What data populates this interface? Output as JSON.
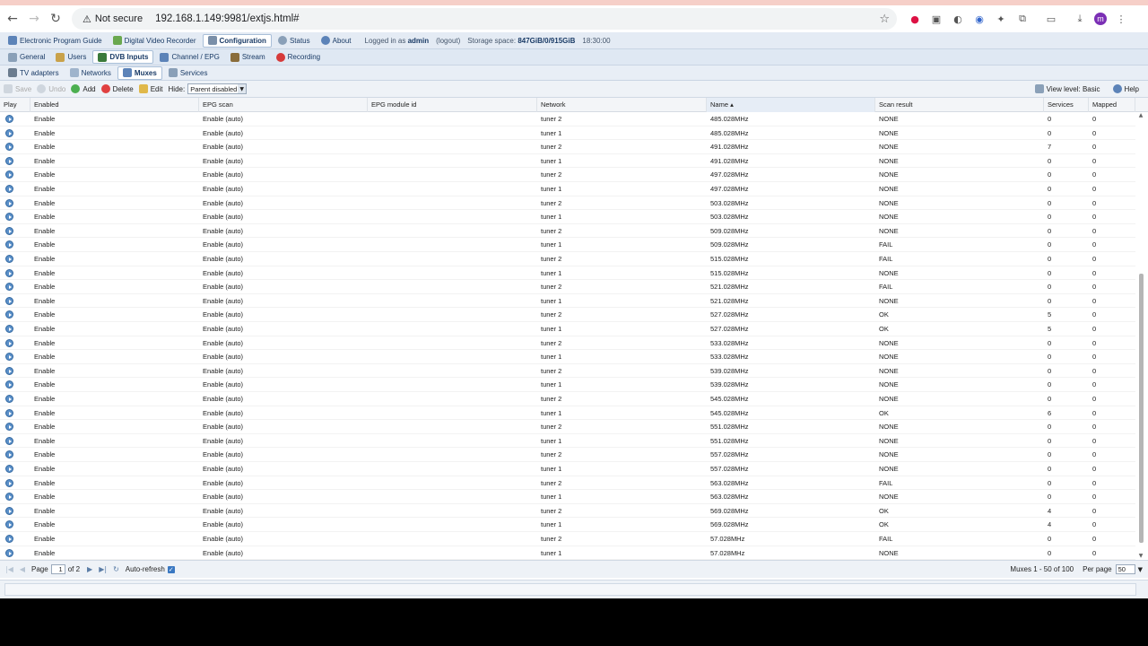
{
  "browser": {
    "security_label": "Not secure",
    "url": "192.168.1.149:9981/extjs.html#",
    "profile_initial": "m"
  },
  "topnav": {
    "tabs": [
      "Electronic Program Guide",
      "Digital Video Recorder",
      "Configuration",
      "Status",
      "About"
    ],
    "logged_in_prefix": "Logged in as",
    "user": "admin",
    "logout": "(logout)",
    "storage_label": "Storage space:",
    "storage_value": "847GiB/0/915GiB",
    "time": "18:30:00"
  },
  "subnav": {
    "tabs": [
      "General",
      "Users",
      "DVB Inputs",
      "Channel / EPG",
      "Stream",
      "Recording"
    ]
  },
  "subnav2": {
    "tabs": [
      "TV adapters",
      "Networks",
      "Muxes",
      "Services"
    ]
  },
  "toolbar": {
    "save": "Save",
    "undo": "Undo",
    "add": "Add",
    "delete": "Delete",
    "edit": "Edit",
    "hide_label": "Hide:",
    "hide_value": "Parent disabled",
    "view_level": "View level: Basic",
    "help": "Help"
  },
  "columns": [
    "Play",
    "Enabled",
    "EPG scan",
    "EPG module id",
    "Network",
    "Name",
    "Scan result",
    "Services",
    "Mapped"
  ],
  "rows": [
    [
      "Enable",
      "Enable (auto)",
      "",
      "tuner 2",
      "485.028MHz",
      "NONE",
      "0",
      "0"
    ],
    [
      "Enable",
      "Enable (auto)",
      "",
      "tuner 1",
      "485.028MHz",
      "NONE",
      "0",
      "0"
    ],
    [
      "Enable",
      "Enable (auto)",
      "",
      "tuner 2",
      "491.028MHz",
      "NONE",
      "7",
      "0"
    ],
    [
      "Enable",
      "Enable (auto)",
      "",
      "tuner 1",
      "491.028MHz",
      "NONE",
      "0",
      "0"
    ],
    [
      "Enable",
      "Enable (auto)",
      "",
      "tuner 2",
      "497.028MHz",
      "NONE",
      "0",
      "0"
    ],
    [
      "Enable",
      "Enable (auto)",
      "",
      "tuner 1",
      "497.028MHz",
      "NONE",
      "0",
      "0"
    ],
    [
      "Enable",
      "Enable (auto)",
      "",
      "tuner 2",
      "503.028MHz",
      "NONE",
      "0",
      "0"
    ],
    [
      "Enable",
      "Enable (auto)",
      "",
      "tuner 1",
      "503.028MHz",
      "NONE",
      "0",
      "0"
    ],
    [
      "Enable",
      "Enable (auto)",
      "",
      "tuner 2",
      "509.028MHz",
      "NONE",
      "0",
      "0"
    ],
    [
      "Enable",
      "Enable (auto)",
      "",
      "tuner 1",
      "509.028MHz",
      "FAIL",
      "0",
      "0"
    ],
    [
      "Enable",
      "Enable (auto)",
      "",
      "tuner 2",
      "515.028MHz",
      "FAIL",
      "0",
      "0"
    ],
    [
      "Enable",
      "Enable (auto)",
      "",
      "tuner 1",
      "515.028MHz",
      "NONE",
      "0",
      "0"
    ],
    [
      "Enable",
      "Enable (auto)",
      "",
      "tuner 2",
      "521.028MHz",
      "FAIL",
      "0",
      "0"
    ],
    [
      "Enable",
      "Enable (auto)",
      "",
      "tuner 1",
      "521.028MHz",
      "NONE",
      "0",
      "0"
    ],
    [
      "Enable",
      "Enable (auto)",
      "",
      "tuner 2",
      "527.028MHz",
      "OK",
      "5",
      "0"
    ],
    [
      "Enable",
      "Enable (auto)",
      "",
      "tuner 1",
      "527.028MHz",
      "OK",
      "5",
      "0"
    ],
    [
      "Enable",
      "Enable (auto)",
      "",
      "tuner 2",
      "533.028MHz",
      "NONE",
      "0",
      "0"
    ],
    [
      "Enable",
      "Enable (auto)",
      "",
      "tuner 1",
      "533.028MHz",
      "NONE",
      "0",
      "0"
    ],
    [
      "Enable",
      "Enable (auto)",
      "",
      "tuner 2",
      "539.028MHz",
      "NONE",
      "0",
      "0"
    ],
    [
      "Enable",
      "Enable (auto)",
      "",
      "tuner 1",
      "539.028MHz",
      "NONE",
      "0",
      "0"
    ],
    [
      "Enable",
      "Enable (auto)",
      "",
      "tuner 2",
      "545.028MHz",
      "NONE",
      "0",
      "0"
    ],
    [
      "Enable",
      "Enable (auto)",
      "",
      "tuner 1",
      "545.028MHz",
      "OK",
      "6",
      "0"
    ],
    [
      "Enable",
      "Enable (auto)",
      "",
      "tuner 2",
      "551.028MHz",
      "NONE",
      "0",
      "0"
    ],
    [
      "Enable",
      "Enable (auto)",
      "",
      "tuner 1",
      "551.028MHz",
      "NONE",
      "0",
      "0"
    ],
    [
      "Enable",
      "Enable (auto)",
      "",
      "tuner 2",
      "557.028MHz",
      "NONE",
      "0",
      "0"
    ],
    [
      "Enable",
      "Enable (auto)",
      "",
      "tuner 1",
      "557.028MHz",
      "NONE",
      "0",
      "0"
    ],
    [
      "Enable",
      "Enable (auto)",
      "",
      "tuner 2",
      "563.028MHz",
      "FAIL",
      "0",
      "0"
    ],
    [
      "Enable",
      "Enable (auto)",
      "",
      "tuner 1",
      "563.028MHz",
      "NONE",
      "0",
      "0"
    ],
    [
      "Enable",
      "Enable (auto)",
      "",
      "tuner 2",
      "569.028MHz",
      "OK",
      "4",
      "0"
    ],
    [
      "Enable",
      "Enable (auto)",
      "",
      "tuner 1",
      "569.028MHz",
      "OK",
      "4",
      "0"
    ],
    [
      "Enable",
      "Enable (auto)",
      "",
      "tuner 2",
      "57.028MHz",
      "FAIL",
      "0",
      "0"
    ],
    [
      "Enable",
      "Enable (auto)",
      "",
      "tuner 1",
      "57.028MHz",
      "NONE",
      "0",
      "0"
    ]
  ],
  "pager": {
    "page_label": "Page",
    "page_value": "1",
    "of_label": "of 2",
    "auto_refresh": "Auto-refresh",
    "summary": "Muxes 1 - 50 of 100",
    "per_page_label": "Per page",
    "per_page_value": "50"
  },
  "colors": {
    "header_bg": "#e4ebf4",
    "accent": "#1a3b66"
  }
}
